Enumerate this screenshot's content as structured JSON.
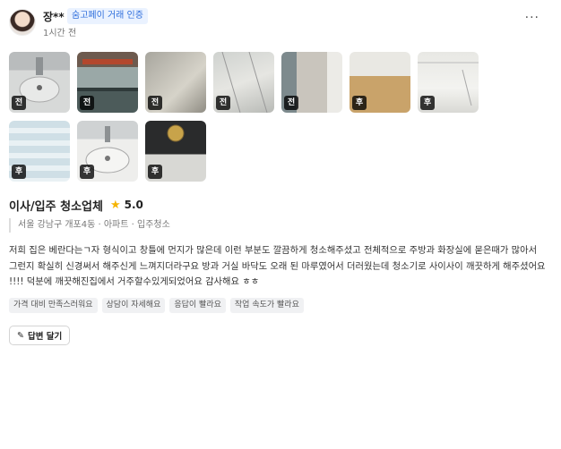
{
  "review": {
    "user": {
      "name": "장**",
      "badge": "숨고페이 거래 인증",
      "time": "1시간 전"
    },
    "more_menu": "···",
    "photos": [
      {
        "tag": "전",
        "subject": "sink"
      },
      {
        "tag": "전",
        "subject": "window-frame"
      },
      {
        "tag": "전",
        "subject": "floor"
      },
      {
        "tag": "전",
        "subject": "ceiling"
      },
      {
        "tag": "전",
        "subject": "balcony"
      },
      {
        "tag": "후",
        "subject": "hallway"
      },
      {
        "tag": "후",
        "subject": "ceiling"
      },
      {
        "tag": "후",
        "subject": "window"
      },
      {
        "tag": "후",
        "subject": "sink"
      },
      {
        "tag": "후",
        "subject": "vent"
      }
    ],
    "service_title": "이사/입주 청소업체",
    "rating": "5.0",
    "meta": "서울 강남구 개포4동 · 아파트 · 입주청소",
    "text": "저희 집은 베란다는ㄱ자 형식이고 창틀에 먼지가 많은데 이런 부분도 깔끔하게 청소해주셨고 전체적으로 주방과 화장실에 묻은때가 많아서 그런지 확실히 신경써서 해주신게 느껴지더라구요 방과 거실 바닥도 오래 된 마루였어서 더러웠는데 청소기로 사이사이 깨끗하게 해주셨어요 !!!! 덕분에 깨끗해진집에서 거주할수있게되었어요 감사해요 ㅎㅎ",
    "tags": [
      "가격 대비 만족스러워요",
      "상담이 자세해요",
      "응답이 빨라요",
      "작업 속도가 빨라요"
    ],
    "reply_label": "답변 달기"
  },
  "colors": {
    "accent": "#2f6fdc",
    "badge_bg": "#eaf2ff",
    "star": "#f5b400"
  },
  "icons": [
    "star-icon",
    "pencil-icon",
    "more-icon"
  ]
}
